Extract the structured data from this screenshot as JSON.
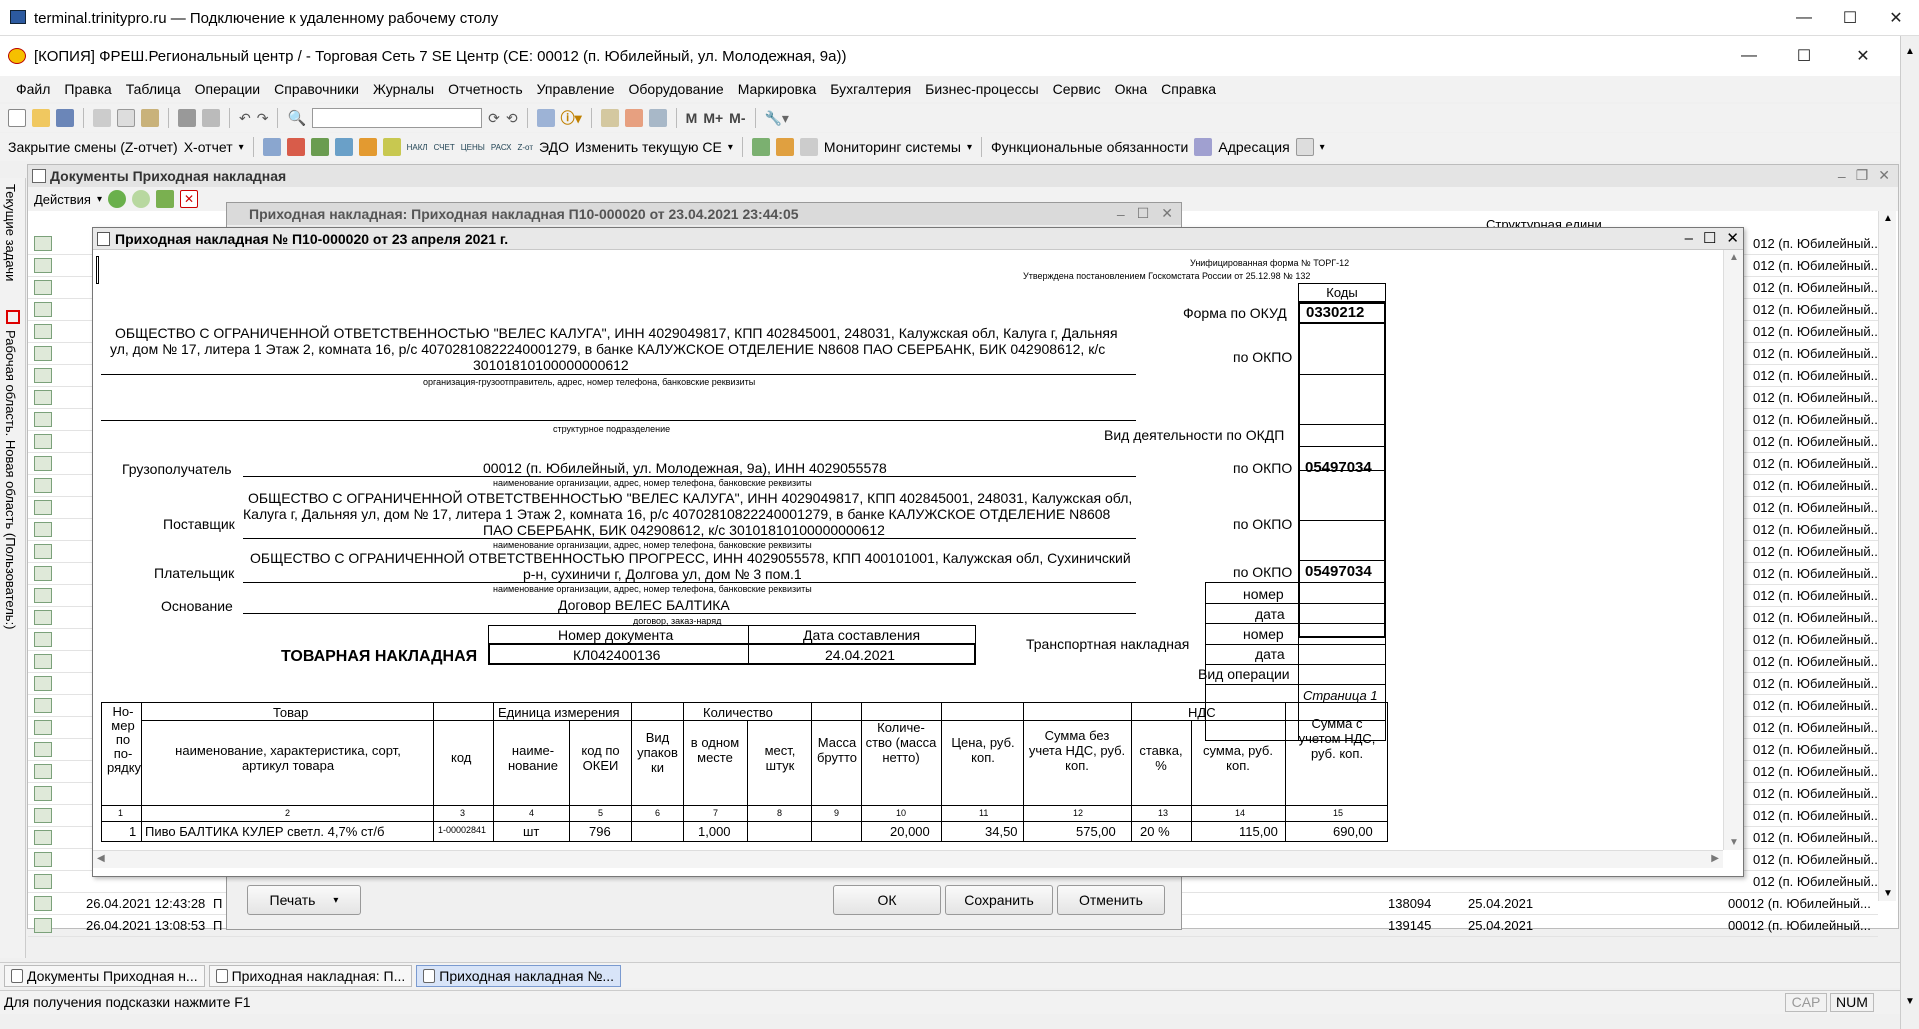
{
  "rdp": {
    "title": "terminal.trinitypro.ru — Подключение к удаленному рабочему столу"
  },
  "app": {
    "title": "[КОПИЯ] ФРЕШ.Региональный центр /  - Торговая Сеть 7 SE Центр (СЕ: 00012 (п. Юбилейный, ул. Молодежная, 9а))"
  },
  "menu": [
    "Файл",
    "Правка",
    "Таблица",
    "Операции",
    "Справочники",
    "Журналы",
    "Отчетность",
    "Управление",
    "Оборудование",
    "Маркировка",
    "Бухгалтерия",
    "Бизнес-процессы",
    "Сервис",
    "Окна",
    "Справка"
  ],
  "toolbar2": {
    "zclose": "Закрытие смены (Z-отчет)",
    "xreport": "Х-отчет",
    "nakl": "НАКЛ",
    "schet": "СЧЕТ",
    "ceny": "ЦЕНЫ",
    "pasx": "РАСХ",
    "edo": "ЭДО",
    "change_ce": "Изменить текущую СЕ",
    "monitoring": "Мониторинг системы",
    "duties": "Функциональные обязанности",
    "addressing": "Адресация"
  },
  "left_panel": {
    "tab1": "Текущие задачи",
    "tab2": "Рабочая область. Новая область (Пользователь:)"
  },
  "doc_list": {
    "title": "Документы Приходная накладная",
    "actions": "Действия",
    "col_last": "Структурная едини..."
  },
  "rows_right": [
    "012 (п. Юбилейный...",
    "012 (п. Юбилейный...",
    "012 (п. Юбилейный...",
    "012 (п. Юбилейный...",
    "012 (п. Юбилейный...",
    "012 (п. Юбилейный...",
    "012 (п. Юбилейный...",
    "012 (п. Юбилейный...",
    "012 (п. Юбилейный...",
    "012 (п. Юбилейный...",
    "012 (п. Юбилейный...",
    "012 (п. Юбилейный...",
    "012 (п. Юбилейный...",
    "012 (п. Юбилейный...",
    "012 (п. Юбилейный...",
    "012 (п. Юбилейный...",
    "012 (п. Юбилейный...",
    "012 (п. Юбилейный...",
    "012 (п. Юбилейный...",
    "012 (п. Юбилейный...",
    "012 (п. Юбилейный...",
    "012 (п. Юбилейный...",
    "012 (п. Юбилейный...",
    "012 (п. Юбилейный...",
    "012 (п. Юбилейный...",
    "012 (п. Юбилейный...",
    "012 (п. Юбилейный...",
    "012 (п. Юбилейный...",
    "012 (п. Юбилейный...",
    "012 (п. Юбилейный..."
  ],
  "bottom_rows": [
    {
      "date": "26.04.2021 12:43:28",
      "t": "П",
      "num": "138094",
      "d2": "25.04.2021",
      "se": "00012 (п. Юбилейный..."
    },
    {
      "date": "26.04.2021 13:08:53",
      "t": "П",
      "num": "139145",
      "d2": "25.04.2021",
      "se": "00012 (п. Юбилейный..."
    }
  ],
  "mid_win": {
    "title": "Приходная накладная: Приходная накладная П10-000020 от 23.04.2021 23:44:05",
    "print": "Печать",
    "ok": "ОК",
    "save": "Сохранить",
    "cancel": "Отменить"
  },
  "front_win": {
    "title": "Приходная накладная № П10-000020 от 23 апреля 2021 г."
  },
  "torg12": {
    "unified": "Унифицированная форма № ТОРГ-12",
    "approved": "Утверждена постановлением Госкомстата России от 25.12.98 № 132",
    "codes": "Коды",
    "okud_label": "Форма по ОКУД",
    "okud": "0330212",
    "okpo_label": "по ОКПО",
    "okdp_label": "Вид деятельности по ОКДП",
    "shipper_1": "ОБЩЕСТВО С ОГРАНИЧЕННОЙ ОТВЕТСТВЕННОСТЬЮ \"ВЕЛЕС КАЛУГА\", ИНН 4029049817, КПП 402845001, 248031, Калужская обл, Калуга г, Дальняя",
    "shipper_2": "ул, дом № 17, литера 1 Этаж 2, комната 16, р/с 40702810822240001279, в банке КАЛУЖСКОЕ ОТДЕЛЕНИЕ N8608 ПАО СБЕРБАНК, БИК 042908612, к/с",
    "shipper_3": "30101810100000000612",
    "shipper_caption": "организация-грузоотправитель, адрес, номер телефона, банковские реквизиты",
    "subdivision_caption": "структурное подразделение",
    "consignee_label": "Грузополучатель",
    "consignee": "00012 (п. Юбилейный, ул. Молодежная, 9а), ИНН 4029055578",
    "consignee_okpo": "05497034",
    "org_caption": "наименование организации, адрес, номер телефона, банковские реквизиты",
    "supplier_label": "Поставщик",
    "supplier_1": "ОБЩЕСТВО С ОГРАНИЧЕННОЙ ОТВЕТСТВЕННОСТЬЮ \"ВЕЛЕС КАЛУГА\", ИНН 4029049817, КПП 402845001, 248031, Калужская обл,",
    "supplier_2": "Калуга г, Дальняя ул, дом № 17, литера 1 Этаж 2, комната 16, р/с 40702810822240001279, в банке КАЛУЖСКОЕ ОТДЕЛЕНИЕ N8608",
    "supplier_3": "ПАО СБЕРБАНК, БИК 042908612, к/с 30101810100000000612",
    "payer_label": "Плательщик",
    "payer_1": "ОБЩЕСТВО С ОГРАНИЧЕННОЙ ОТВЕТСТВЕННОСТЬЮ ПРОГРЕСС, ИНН 4029055578, КПП 400101001, Калужская обл, Сухиничский",
    "payer_2": "р-н, сухиничи г, Долгова ул, дом № 3 пом.1",
    "payer_okpo": "05497034",
    "basis_label": "Основание",
    "basis": "Договор ВЕЛЕС БАЛТИКА",
    "basis_caption": "договор, заказ-наряд",
    "num_label": "номер",
    "date_label": "дата",
    "transport_label": "Транспортная накладная",
    "optype_label": "Вид операции",
    "doc_num_hdr": "Номер документа",
    "doc_date_hdr": "Дата составления",
    "doc_num": "КЛ042400136",
    "doc_date": "24.04.2021",
    "heading": "ТОВАРНАЯ НАКЛАДНАЯ",
    "page": "Страница 1",
    "hdr_no": "Но-мер по по-рядку",
    "hdr_goods": "Товар",
    "hdr_goods_name": "наименование, характеристика, сорт, артикул товара",
    "hdr_code": "код",
    "hdr_unit": "Единица измерения",
    "hdr_unit_name": "наиме-нование",
    "hdr_okei": "код по ОКЕИ",
    "hdr_pack": "Вид упаков ки",
    "hdr_qty": "Количество",
    "hdr_qty_one": "в одном месте",
    "hdr_qty_places": "мест, штук",
    "hdr_gross": "Масса брутто",
    "hdr_net": "Количе-ство (масса нетто)",
    "hdr_price": "Цена, руб. коп.",
    "hdr_sum_wo": "Сумма без учета НДС, руб. коп.",
    "hdr_vat": "НДС",
    "hdr_vat_rate": "ставка, %",
    "hdr_vat_sum": "сумма, руб. коп.",
    "hdr_sum_w": "Сумма с учетом НДС, руб. коп.",
    "col_nums": [
      "1",
      "2",
      "3",
      "4",
      "5",
      "6",
      "7",
      "8",
      "9",
      "10",
      "11",
      "12",
      "13",
      "14",
      "15"
    ],
    "item": {
      "n": "1",
      "name": "Пиво БАЛТИКА КУЛЕР светл. 4,7% ст/б",
      "code": "1-00002841",
      "unit": "шт",
      "okei": "796",
      "qty_one": "1,000",
      "net": "20,000",
      "price": "34,50",
      "sum_wo": "575,00",
      "vat_rate": "20 %",
      "vat_sum": "115,00",
      "sum_w": "690,00"
    }
  },
  "taskbar": [
    "Документы Приходная н...",
    "Приходная накладная: П...",
    "Приходная накладная №..."
  ],
  "status": {
    "hint": "Для получения подсказки нажмите F1",
    "cap": "CAP",
    "num": "NUM"
  }
}
